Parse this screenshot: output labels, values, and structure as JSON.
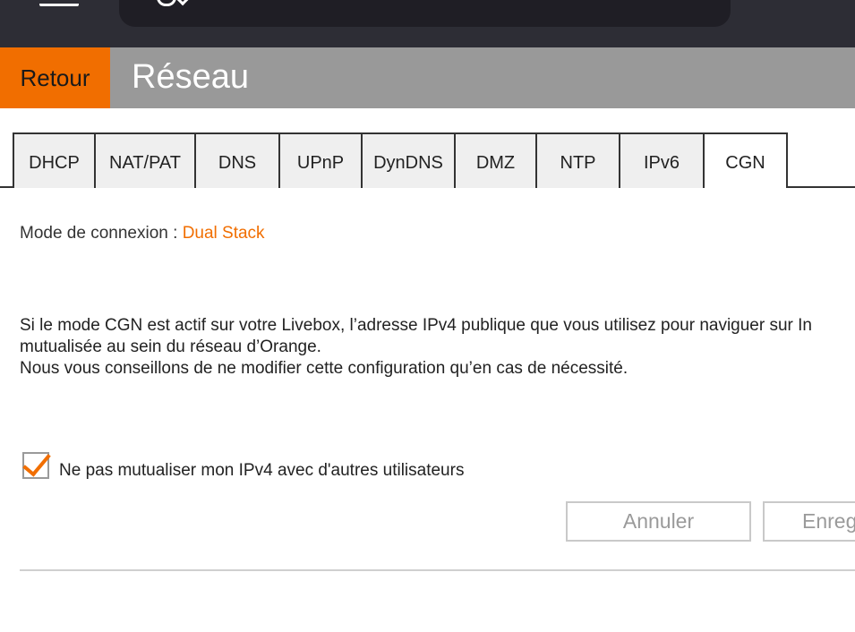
{
  "header": {
    "back_label": "Retour",
    "title": "Réseau"
  },
  "tabs": [
    {
      "label": "DHCP",
      "active": false
    },
    {
      "label": "NAT/PAT",
      "active": false
    },
    {
      "label": "DNS",
      "active": false
    },
    {
      "label": "UPnP",
      "active": false
    },
    {
      "label": "DynDNS",
      "active": false
    },
    {
      "label": "DMZ",
      "active": false
    },
    {
      "label": "NTP",
      "active": false
    },
    {
      "label": "IPv6",
      "active": false
    },
    {
      "label": "CGN",
      "active": true
    }
  ],
  "connection": {
    "label": "Mode de connexion :",
    "value": "Dual Stack"
  },
  "description": {
    "line1": "Si le mode CGN est actif sur votre Livebox, l’adresse IPv4 publique que vous utilisez pour naviguer sur In",
    "line2": "mutualisée au sein du réseau d’Orange.",
    "line3": "Nous vous conseillons de ne modifier cette configuration qu’en cas de nécessité."
  },
  "option": {
    "label": "Ne pas mutualiser mon IPv4 avec d'autres utilisateurs",
    "checked": true
  },
  "actions": {
    "cancel_label": "Annuler",
    "save_label": "Enreg"
  },
  "colors": {
    "accent": "#f16e00",
    "header_bg": "#999999",
    "topbar_bg": "#2d2d35"
  }
}
